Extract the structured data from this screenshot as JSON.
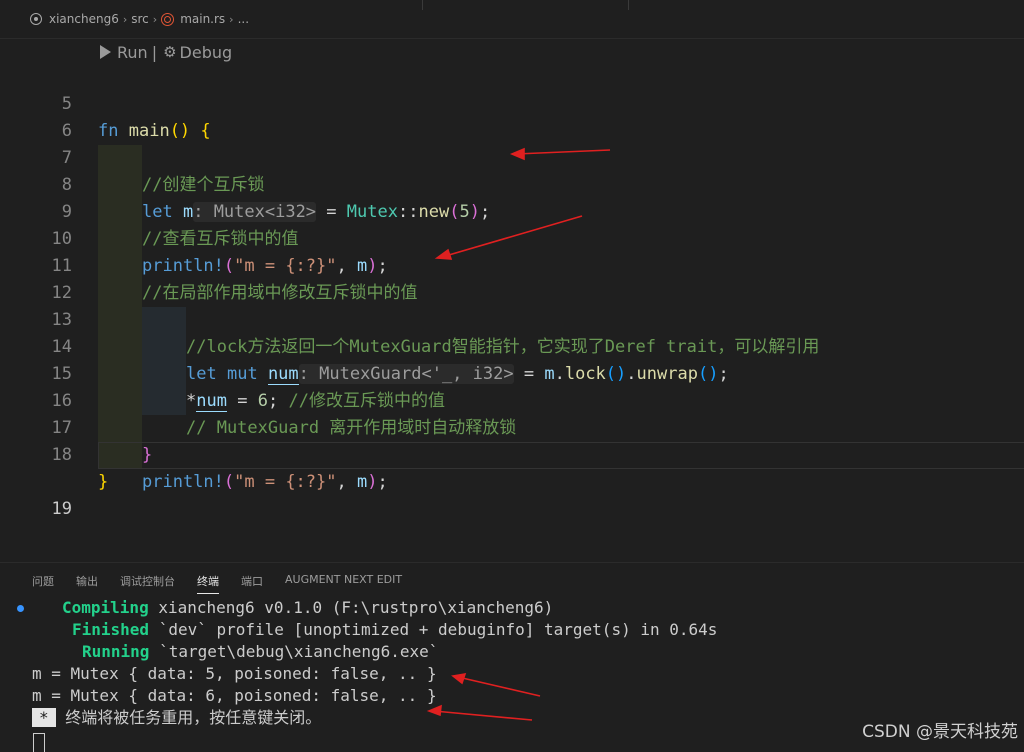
{
  "breadcrumb": {
    "project": "xiancheng6",
    "folder": "src",
    "file": "main.rs",
    "more": "..."
  },
  "codelens": {
    "run": "Run",
    "divider": "|",
    "debug": "Debug"
  },
  "line_numbers": [
    "5",
    "6",
    "7",
    "8",
    "9",
    "10",
    "11",
    "12",
    "13",
    "14",
    "15",
    "16",
    "17",
    "18",
    "19"
  ],
  "code": {
    "l6_comment": "//创建个互斥锁",
    "l8_comment": "//查看互斥锁中的值",
    "l10_comment": "//在局部作用域中修改互斥锁中的值",
    "l12_comment": "//lock方法返回一个MutexGuard智能指针，它实现了Deref trait，可以解引用",
    "l14_comment": "//修改互斥锁中的值",
    "l15_comment": "// MutexGuard 离开作用域时自动释放锁",
    "fmt_string": "\"m = {:?}\""
  },
  "panel": {
    "tabs": [
      "问题",
      "输出",
      "调试控制台",
      "终端",
      "端口",
      "AUGMENT NEXT EDIT"
    ],
    "active_tab": "终端"
  },
  "terminal": {
    "compiling_label": "Compiling",
    "compiling_text": " xiancheng6 v0.1.0 (F:\\rustpro\\xiancheng6)",
    "finished_label": "Finished",
    "finished_text": " `dev` profile [unoptimized + debuginfo] target(s) in 0.64s",
    "running_label": "Running",
    "running_text": " `target\\debug\\xiancheng6.exe`",
    "out1": "m = Mutex { data: 5, poisoned: false, .. }",
    "out2": "m = Mutex { data: 6, poisoned: false, .. }",
    "prompt_star": "*",
    "prompt_text": " 终端将被任务重用，按任意键关闭。"
  },
  "watermark": "CSDN @景天科技苑",
  "colors": {
    "background": "#1f1f1f",
    "annotation_arrow": "#e02020",
    "terminal_green": "#23d18b"
  },
  "icons": [
    "circle-dot-icon",
    "rust-icon",
    "play-icon",
    "gear-icon"
  ]
}
